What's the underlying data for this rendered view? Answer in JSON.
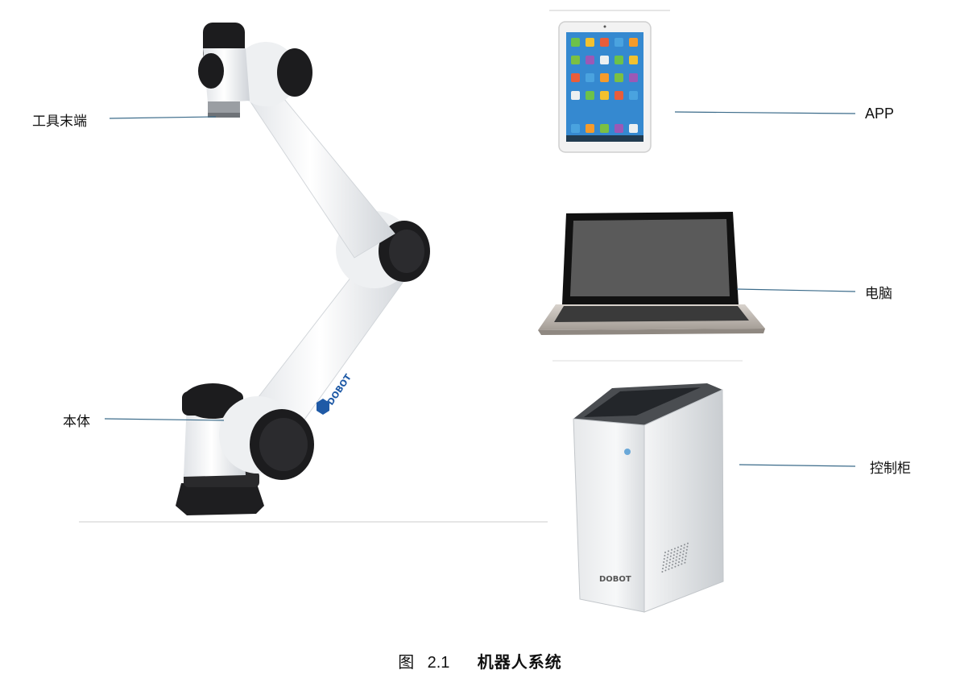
{
  "labels": {
    "tool_end": "工具末端",
    "body": "本体",
    "app": "APP",
    "computer": "电脑",
    "control_cabinet": "控制柜"
  },
  "caption": {
    "prefix": "图",
    "number": "2.1",
    "title": "机器人系统"
  },
  "brand": {
    "arm_logo_text": "DOBOT",
    "cabinet_logo_text": "DOBOT"
  },
  "colors": {
    "leader_line": "#3b6b8a",
    "arm_white": "#f4f5f7",
    "joint_black": "#1c1c1e",
    "brand_blue": "#1f5aa6"
  }
}
